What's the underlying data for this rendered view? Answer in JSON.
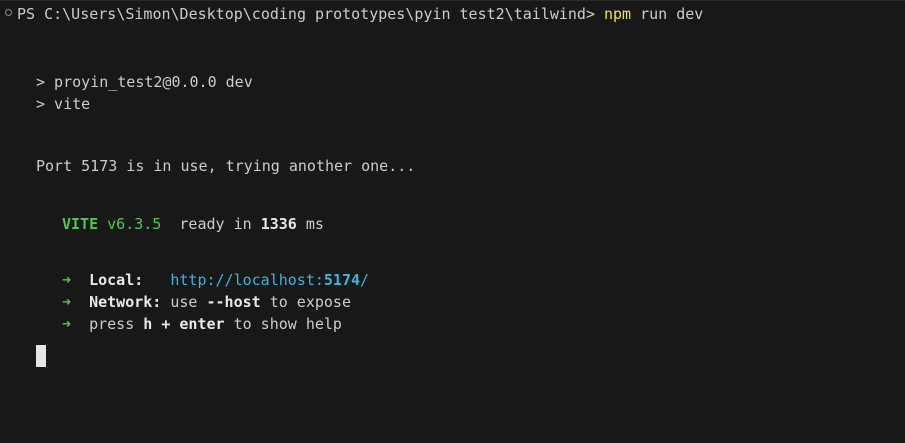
{
  "prompt": {
    "path": "PS C:\\Users\\Simon\\Desktop\\coding prototypes\\pyin test2\\tailwind>",
    "cmd_npm": "npm",
    "cmd_rest": "run dev"
  },
  "output": {
    "script_line": "> proyin_test2@0.0.0 dev",
    "vite_line": "> vite",
    "port_msg": "Port 5173 is in use, trying another one...",
    "vite_name": "VITE",
    "vite_version": "v6.3.5",
    "ready_text": "ready in",
    "ready_ms": "1336",
    "ready_unit": "ms",
    "arrow": "➜",
    "local_label": "Local:",
    "local_url_base": "http://localhost:",
    "local_url_port": "5174",
    "local_url_slash": "/",
    "network_label": "Network:",
    "network_pre": "use",
    "network_flag": "--host",
    "network_post": "to expose",
    "help_pre": "press",
    "help_key": "h + enter",
    "help_post": "to show help"
  },
  "colors": {
    "background": "#181818",
    "text": "#cccccc",
    "command": "#f0e058",
    "green": "#4ec94e",
    "url": "#3fb3d8"
  }
}
